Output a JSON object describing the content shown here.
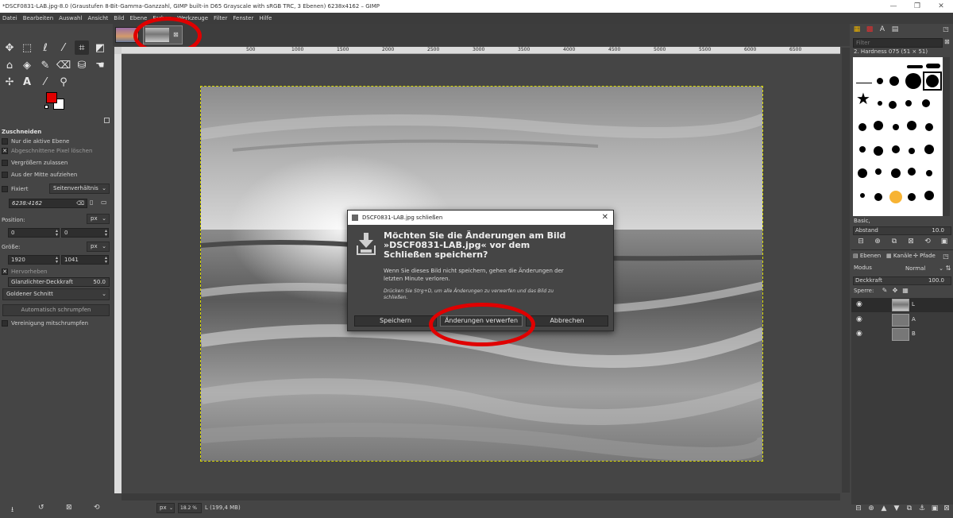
{
  "window": {
    "title": "*DSCF0831-LAB.jpg-8.0 (Graustufen 8-Bit-Gamma-Ganzzahl, GIMP built-in D65 Grayscale with sRGB TRC, 3 Ebenen) 6238x4162 – GIMP",
    "controls": [
      "—",
      "❐",
      "✕"
    ]
  },
  "menubar": {
    "items": [
      "Datei",
      "Bearbeiten",
      "Auswahl",
      "Ansicht",
      "Bild",
      "Ebene",
      "Farben",
      "Werkzeuge",
      "Filter",
      "Fenster",
      "Hilfe"
    ]
  },
  "tool_options": {
    "title": "Zuschneiden",
    "only_active_layer": "Nur die aktive Ebene",
    "delete_cropped": "Abgeschnittene Pixel löschen",
    "allow_growing": "Vergrößern zulassen",
    "expand_center": "Aus der Mitte aufziehen",
    "fixed": "Fixiert",
    "aspect": "Seitenverhältnis",
    "ratio_value": "6238:4162",
    "position_label": "Position:",
    "position_unit": "px",
    "pos_x": "0",
    "pos_y": "0",
    "size_label": "Größe:",
    "size_unit": "px",
    "size_w": "1920",
    "size_h": "1041",
    "highlight": "Hervorheben",
    "highlight_opacity_label": "Glanzlichter-Deckkraft",
    "highlight_opacity_value": "50.0",
    "guides": "Goldener Schnitt",
    "auto_shrink": "Automatisch schrumpfen",
    "shrink_merged": "Vereinigung mitschrumpfen"
  },
  "ruler": {
    "ticks": [
      "500",
      "1000",
      "1500",
      "2000",
      "2500",
      "3000",
      "3500",
      "4000",
      "4500",
      "5000",
      "5500",
      "6000",
      "6500"
    ]
  },
  "statusbar": {
    "unit": "px",
    "zoom": "18.2 %",
    "info": "L (199,4 MB)"
  },
  "brushes": {
    "filter_placeholder": "Filter",
    "selected": "2. Hardness 075 (51 × 51)",
    "preset": "Basic,",
    "spacing_label": "Abstand",
    "spacing_value": "10.0"
  },
  "layers_panel": {
    "tabs": [
      "Ebenen",
      "Kanäle",
      "Pfade"
    ],
    "mode_label": "Modus",
    "mode_value": "Normal",
    "opacity_label": "Deckkraft",
    "opacity_value": "100.0",
    "lock_label": "Sperre:",
    "layers": [
      {
        "name": "L"
      },
      {
        "name": "A"
      },
      {
        "name": "B"
      }
    ]
  },
  "dialog": {
    "title": "DSCF0831-LAB.jpg schließen",
    "heading": "Möchten Sie die Änderungen am Bild »DSCF0831-LAB.jpg« vor dem Schließen speichern?",
    "body": "Wenn Sie dieses Bild nicht speichern, gehen die Änderungen der letzten Minute verloren.",
    "hint": "Drücken Sie Strg+D, um alle Änderungen zu verwerfen und das Bild zu schließen.",
    "buttons": {
      "save": "Speichern",
      "discard": "Änderungen verwerfen",
      "cancel": "Abbrechen"
    }
  },
  "colors": {
    "annotation_red": "#e00000",
    "fg_color": "#e00000",
    "bg_color": "#ffffff",
    "selection_outline": "#d8d800"
  }
}
